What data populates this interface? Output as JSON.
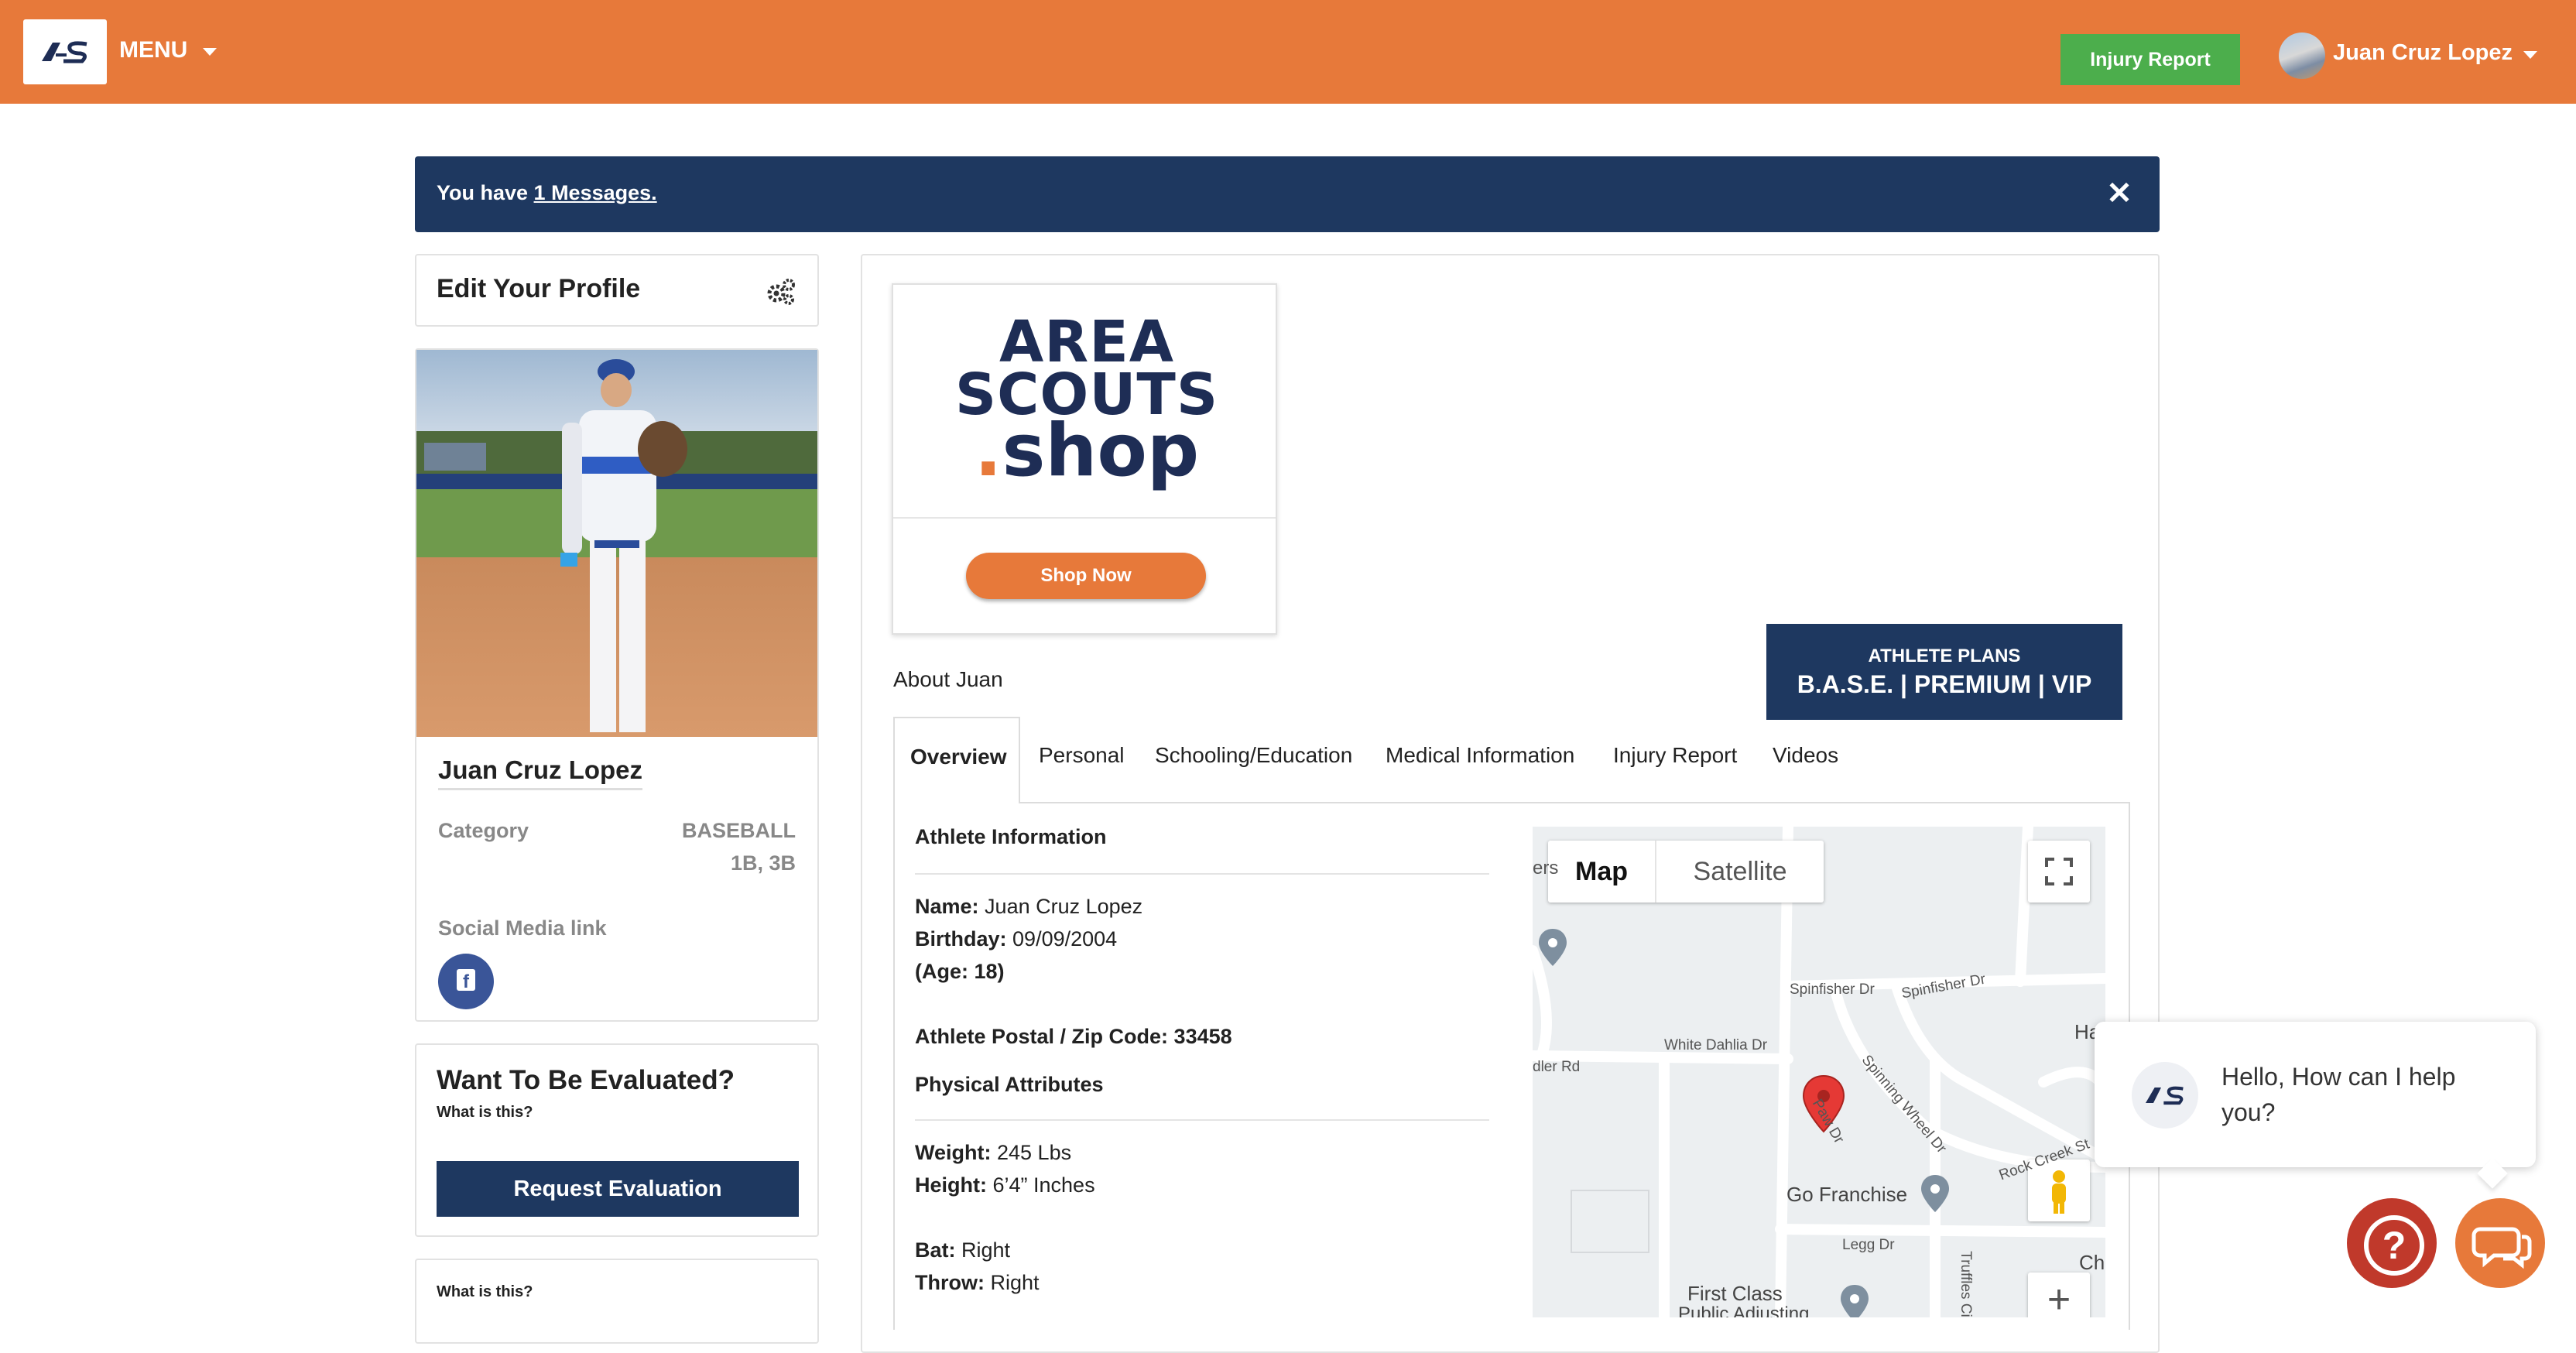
{
  "topbar": {
    "logo_text": "AS",
    "menu_label": "MENU",
    "injury_report_button": "Injury Report",
    "user_name": "Juan Cruz Lopez"
  },
  "message_bar": {
    "prefix": "You have ",
    "link": "1 Messages."
  },
  "sidebar": {
    "edit_profile_title": "Edit Your Profile",
    "profile_name": "Juan Cruz Lopez",
    "category_label": "Category",
    "category_value": "BASEBALL",
    "position_value": "1B, 3B",
    "social_label": "Social Media link",
    "evaluate_title": "Want To Be Evaluated?",
    "what_is_this": "What is this?",
    "request_button": "Request Evaluation",
    "what_is_this_2": "What is this?"
  },
  "shop": {
    "logo_line1": "AREA",
    "logo_line2": "SCOUTS",
    "logo_line3_dot": ".",
    "logo_line3": "shop",
    "button": "Shop Now"
  },
  "plans": {
    "title": "ATHLETE PLANS",
    "tiers": "B.A.S.E. | PREMIUM | VIP"
  },
  "about_label": "About Juan",
  "tabs": [
    "Overview",
    "Personal",
    "Schooling/Education",
    "Medical Information",
    "Injury Report",
    "Videos"
  ],
  "overview": {
    "athlete_info_heading": "Athlete Information",
    "name_label": "Name:",
    "name_value": "Juan Cruz Lopez",
    "birthday_label": "Birthday:",
    "birthday_value": "09/09/2004",
    "age_text": "(Age: 18)",
    "postal_label": "Athlete Postal / Zip Code:",
    "postal_value": "33458",
    "physical_heading": "Physical Attributes",
    "weight_label": "Weight:",
    "weight_value": "245 Lbs",
    "height_label": "Height:",
    "height_value": "6’4” Inches",
    "bat_label": "Bat:",
    "bat_value": "Right",
    "throw_label": "Throw:",
    "throw_value": "Right"
  },
  "map": {
    "map_button": "Map",
    "satellite_button": "Satellite",
    "roads": [
      "Spinfisher Dr",
      "Spinfisher Dr",
      "White Dahlia Dr",
      "dler Rd",
      "Spinning Wheel Dr",
      "Rock Creek St",
      "Legg Dr",
      "Go Franchise",
      "First Class",
      "Public Adjusting",
      "Truffles Ci",
      "Ha",
      "Ch",
      "ers",
      "Paw Dr"
    ]
  },
  "chat": {
    "greeting": "Hello, How can I help you?"
  }
}
